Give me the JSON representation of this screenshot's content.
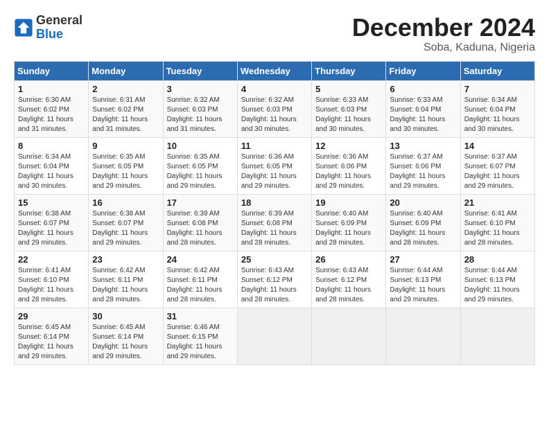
{
  "header": {
    "logo_line1": "General",
    "logo_line2": "Blue",
    "month": "December 2024",
    "location": "Soba, Kaduna, Nigeria"
  },
  "weekdays": [
    "Sunday",
    "Monday",
    "Tuesday",
    "Wednesday",
    "Thursday",
    "Friday",
    "Saturday"
  ],
  "weeks": [
    [
      {
        "day": "1",
        "sunrise": "Sunrise: 6:30 AM",
        "sunset": "Sunset: 6:02 PM",
        "daylight": "Daylight: 11 hours and 31 minutes."
      },
      {
        "day": "2",
        "sunrise": "Sunrise: 6:31 AM",
        "sunset": "Sunset: 6:02 PM",
        "daylight": "Daylight: 11 hours and 31 minutes."
      },
      {
        "day": "3",
        "sunrise": "Sunrise: 6:32 AM",
        "sunset": "Sunset: 6:03 PM",
        "daylight": "Daylight: 11 hours and 31 minutes."
      },
      {
        "day": "4",
        "sunrise": "Sunrise: 6:32 AM",
        "sunset": "Sunset: 6:03 PM",
        "daylight": "Daylight: 11 hours and 30 minutes."
      },
      {
        "day": "5",
        "sunrise": "Sunrise: 6:33 AM",
        "sunset": "Sunset: 6:03 PM",
        "daylight": "Daylight: 11 hours and 30 minutes."
      },
      {
        "day": "6",
        "sunrise": "Sunrise: 6:33 AM",
        "sunset": "Sunset: 6:04 PM",
        "daylight": "Daylight: 11 hours and 30 minutes."
      },
      {
        "day": "7",
        "sunrise": "Sunrise: 6:34 AM",
        "sunset": "Sunset: 6:04 PM",
        "daylight": "Daylight: 11 hours and 30 minutes."
      }
    ],
    [
      {
        "day": "8",
        "sunrise": "Sunrise: 6:34 AM",
        "sunset": "Sunset: 6:04 PM",
        "daylight": "Daylight: 11 hours and 30 minutes."
      },
      {
        "day": "9",
        "sunrise": "Sunrise: 6:35 AM",
        "sunset": "Sunset: 6:05 PM",
        "daylight": "Daylight: 11 hours and 29 minutes."
      },
      {
        "day": "10",
        "sunrise": "Sunrise: 6:35 AM",
        "sunset": "Sunset: 6:05 PM",
        "daylight": "Daylight: 11 hours and 29 minutes."
      },
      {
        "day": "11",
        "sunrise": "Sunrise: 6:36 AM",
        "sunset": "Sunset: 6:05 PM",
        "daylight": "Daylight: 11 hours and 29 minutes."
      },
      {
        "day": "12",
        "sunrise": "Sunrise: 6:36 AM",
        "sunset": "Sunset: 6:06 PM",
        "daylight": "Daylight: 11 hours and 29 minutes."
      },
      {
        "day": "13",
        "sunrise": "Sunrise: 6:37 AM",
        "sunset": "Sunset: 6:06 PM",
        "daylight": "Daylight: 11 hours and 29 minutes."
      },
      {
        "day": "14",
        "sunrise": "Sunrise: 6:37 AM",
        "sunset": "Sunset: 6:07 PM",
        "daylight": "Daylight: 11 hours and 29 minutes."
      }
    ],
    [
      {
        "day": "15",
        "sunrise": "Sunrise: 6:38 AM",
        "sunset": "Sunset: 6:07 PM",
        "daylight": "Daylight: 11 hours and 29 minutes."
      },
      {
        "day": "16",
        "sunrise": "Sunrise: 6:38 AM",
        "sunset": "Sunset: 6:07 PM",
        "daylight": "Daylight: 11 hours and 29 minutes."
      },
      {
        "day": "17",
        "sunrise": "Sunrise: 6:39 AM",
        "sunset": "Sunset: 6:08 PM",
        "daylight": "Daylight: 11 hours and 28 minutes."
      },
      {
        "day": "18",
        "sunrise": "Sunrise: 6:39 AM",
        "sunset": "Sunset: 6:08 PM",
        "daylight": "Daylight: 11 hours and 28 minutes."
      },
      {
        "day": "19",
        "sunrise": "Sunrise: 6:40 AM",
        "sunset": "Sunset: 6:09 PM",
        "daylight": "Daylight: 11 hours and 28 minutes."
      },
      {
        "day": "20",
        "sunrise": "Sunrise: 6:40 AM",
        "sunset": "Sunset: 6:09 PM",
        "daylight": "Daylight: 11 hours and 28 minutes."
      },
      {
        "day": "21",
        "sunrise": "Sunrise: 6:41 AM",
        "sunset": "Sunset: 6:10 PM",
        "daylight": "Daylight: 11 hours and 28 minutes."
      }
    ],
    [
      {
        "day": "22",
        "sunrise": "Sunrise: 6:41 AM",
        "sunset": "Sunset: 6:10 PM",
        "daylight": "Daylight: 11 hours and 28 minutes."
      },
      {
        "day": "23",
        "sunrise": "Sunrise: 6:42 AM",
        "sunset": "Sunset: 6:11 PM",
        "daylight": "Daylight: 11 hours and 28 minutes."
      },
      {
        "day": "24",
        "sunrise": "Sunrise: 6:42 AM",
        "sunset": "Sunset: 6:11 PM",
        "daylight": "Daylight: 11 hours and 28 minutes."
      },
      {
        "day": "25",
        "sunrise": "Sunrise: 6:43 AM",
        "sunset": "Sunset: 6:12 PM",
        "daylight": "Daylight: 11 hours and 28 minutes."
      },
      {
        "day": "26",
        "sunrise": "Sunrise: 6:43 AM",
        "sunset": "Sunset: 6:12 PM",
        "daylight": "Daylight: 11 hours and 28 minutes."
      },
      {
        "day": "27",
        "sunrise": "Sunrise: 6:44 AM",
        "sunset": "Sunset: 6:13 PM",
        "daylight": "Daylight: 11 hours and 29 minutes."
      },
      {
        "day": "28",
        "sunrise": "Sunrise: 6:44 AM",
        "sunset": "Sunset: 6:13 PM",
        "daylight": "Daylight: 11 hours and 29 minutes."
      }
    ],
    [
      {
        "day": "29",
        "sunrise": "Sunrise: 6:45 AM",
        "sunset": "Sunset: 6:14 PM",
        "daylight": "Daylight: 11 hours and 29 minutes."
      },
      {
        "day": "30",
        "sunrise": "Sunrise: 6:45 AM",
        "sunset": "Sunset: 6:14 PM",
        "daylight": "Daylight: 11 hours and 29 minutes."
      },
      {
        "day": "31",
        "sunrise": "Sunrise: 6:46 AM",
        "sunset": "Sunset: 6:15 PM",
        "daylight": "Daylight: 11 hours and 29 minutes."
      },
      null,
      null,
      null,
      null
    ]
  ]
}
